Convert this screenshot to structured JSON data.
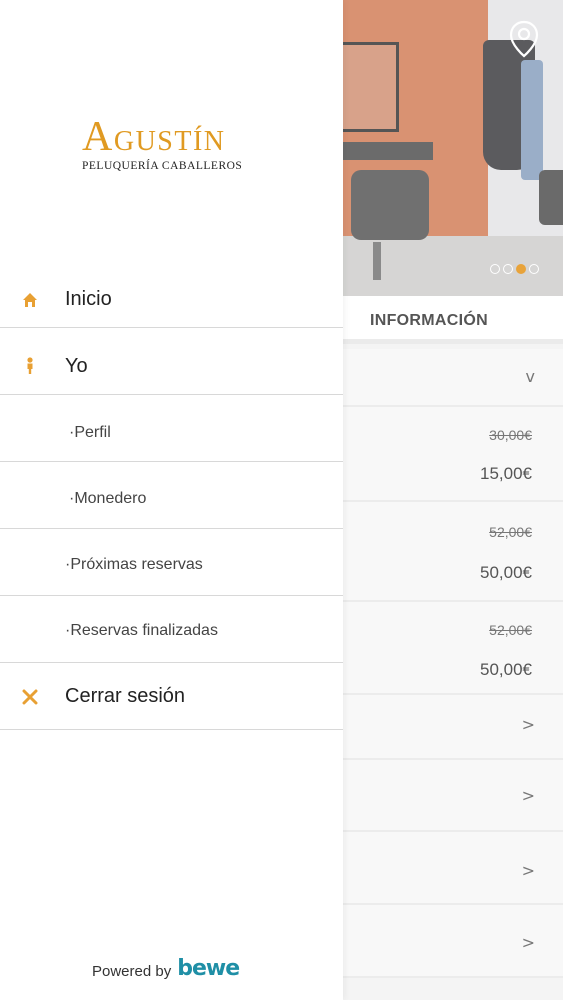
{
  "drawer": {
    "logo": {
      "main": "AGUSTÍN",
      "sub": "PELUQUERÍA CABALLEROS"
    },
    "items": [
      {
        "label": "Inicio",
        "icon": "home-icon"
      },
      {
        "label": "Yo",
        "icon": "person-icon"
      },
      {
        "label": "·Perfil"
      },
      {
        "label": "·Monedero"
      },
      {
        "label": "·Próximas reservas"
      },
      {
        "label": "·Reservas finalizadas"
      },
      {
        "label": "Cerrar sesión",
        "icon": "close-icon"
      }
    ],
    "powered_by": "Powered by",
    "brand": "bewe"
  },
  "page": {
    "section_title": "INFORMACIÓN",
    "carousel": {
      "dots": 4,
      "active": 3
    },
    "prices": [
      {
        "old": "30,00€",
        "new": "15,00€"
      },
      {
        "old": "52,00€",
        "new": "50,00€"
      },
      {
        "old": "52,00€",
        "new": "50,00€"
      }
    ],
    "chevron_down": "v",
    "chevron_right": ">"
  },
  "colors": {
    "accent": "#e8a033",
    "brand": "#1f8fa6"
  }
}
